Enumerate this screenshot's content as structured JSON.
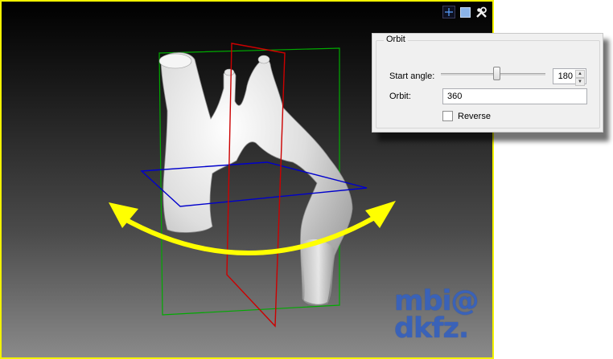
{
  "panel": {
    "title": "Orbit",
    "start_angle_label": "Start angle:",
    "start_angle_value": "180",
    "start_angle_slider_fraction": 0.5,
    "orbit_label": "Orbit:",
    "orbit_value": "360",
    "reverse_label": "Reverse",
    "reverse_checked": false
  },
  "toolbar": {
    "icons": [
      "crosshair-icon",
      "maximize-icon",
      "tools-icon"
    ]
  },
  "logo": {
    "line1": "mbi@",
    "line2": "dkfz."
  },
  "colors": {
    "viewport_border": "#f2f200",
    "arrow": "#ffff00",
    "axial_plane": "#0000cc",
    "sagittal_plane": "#cc0000",
    "coronal_plane": "#00aa00",
    "logo": "#3a62b8"
  }
}
